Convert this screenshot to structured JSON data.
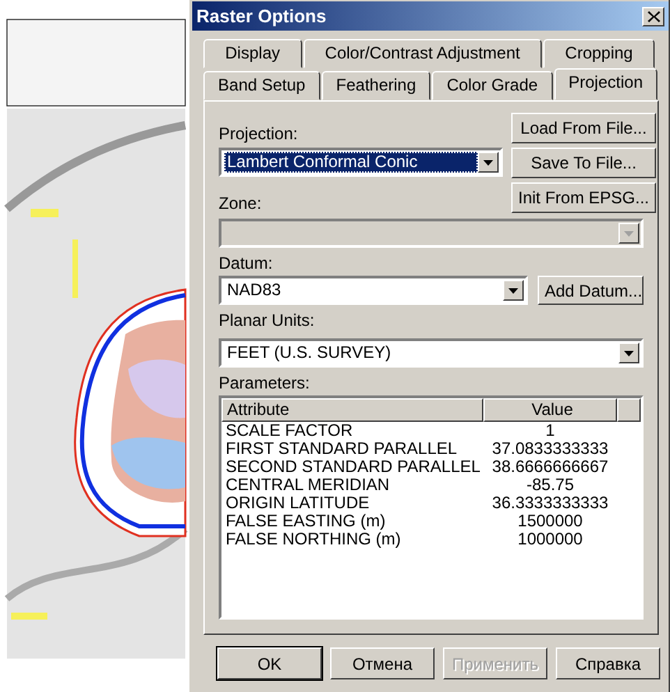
{
  "window": {
    "title": "Raster Options"
  },
  "tab_rows": [
    [
      {
        "label": "Display",
        "selected": false
      },
      {
        "label": "Color/Contrast Adjustment",
        "selected": false
      },
      {
        "label": "Cropping",
        "selected": false
      }
    ],
    [
      {
        "label": "Band Setup",
        "selected": false
      },
      {
        "label": "Feathering",
        "selected": false
      },
      {
        "label": "Color Grade",
        "selected": false
      },
      {
        "label": "Projection",
        "selected": true
      }
    ]
  ],
  "projection": {
    "label": "Projection:",
    "value": "Lambert Conformal Conic",
    "focused": true
  },
  "side_buttons": [
    "Load From File...",
    "Save To File...",
    "Init From EPSG..."
  ],
  "zone": {
    "label": "Zone:",
    "disabled": true
  },
  "datum": {
    "label": "Datum:",
    "value": "NAD83",
    "button": "Add Datum..."
  },
  "planar_units": {
    "label": "Planar Units:",
    "value": "FEET (U.S. SURVEY)"
  },
  "parameters": {
    "label": "Parameters:",
    "columns": [
      "Attribute",
      "Value"
    ],
    "rows": [
      [
        "SCALE FACTOR",
        "1"
      ],
      [
        "FIRST STANDARD PARALLEL",
        "37.0833333333"
      ],
      [
        "SECOND STANDARD PARALLEL",
        "38.6666666667"
      ],
      [
        "CENTRAL MERIDIAN",
        "-85.75"
      ],
      [
        "ORIGIN LATITUDE",
        "36.3333333333"
      ],
      [
        "FALSE EASTING (m)",
        "1500000"
      ],
      [
        "FALSE NORTHING (m)",
        "1000000"
      ]
    ]
  },
  "buttons": [
    {
      "label": "OK",
      "default": true,
      "disabled": false
    },
    {
      "label": "Отмена",
      "default": false,
      "disabled": false
    },
    {
      "label": "Применить",
      "default": false,
      "disabled": true
    },
    {
      "label": "Справка",
      "default": false,
      "disabled": false
    }
  ]
}
